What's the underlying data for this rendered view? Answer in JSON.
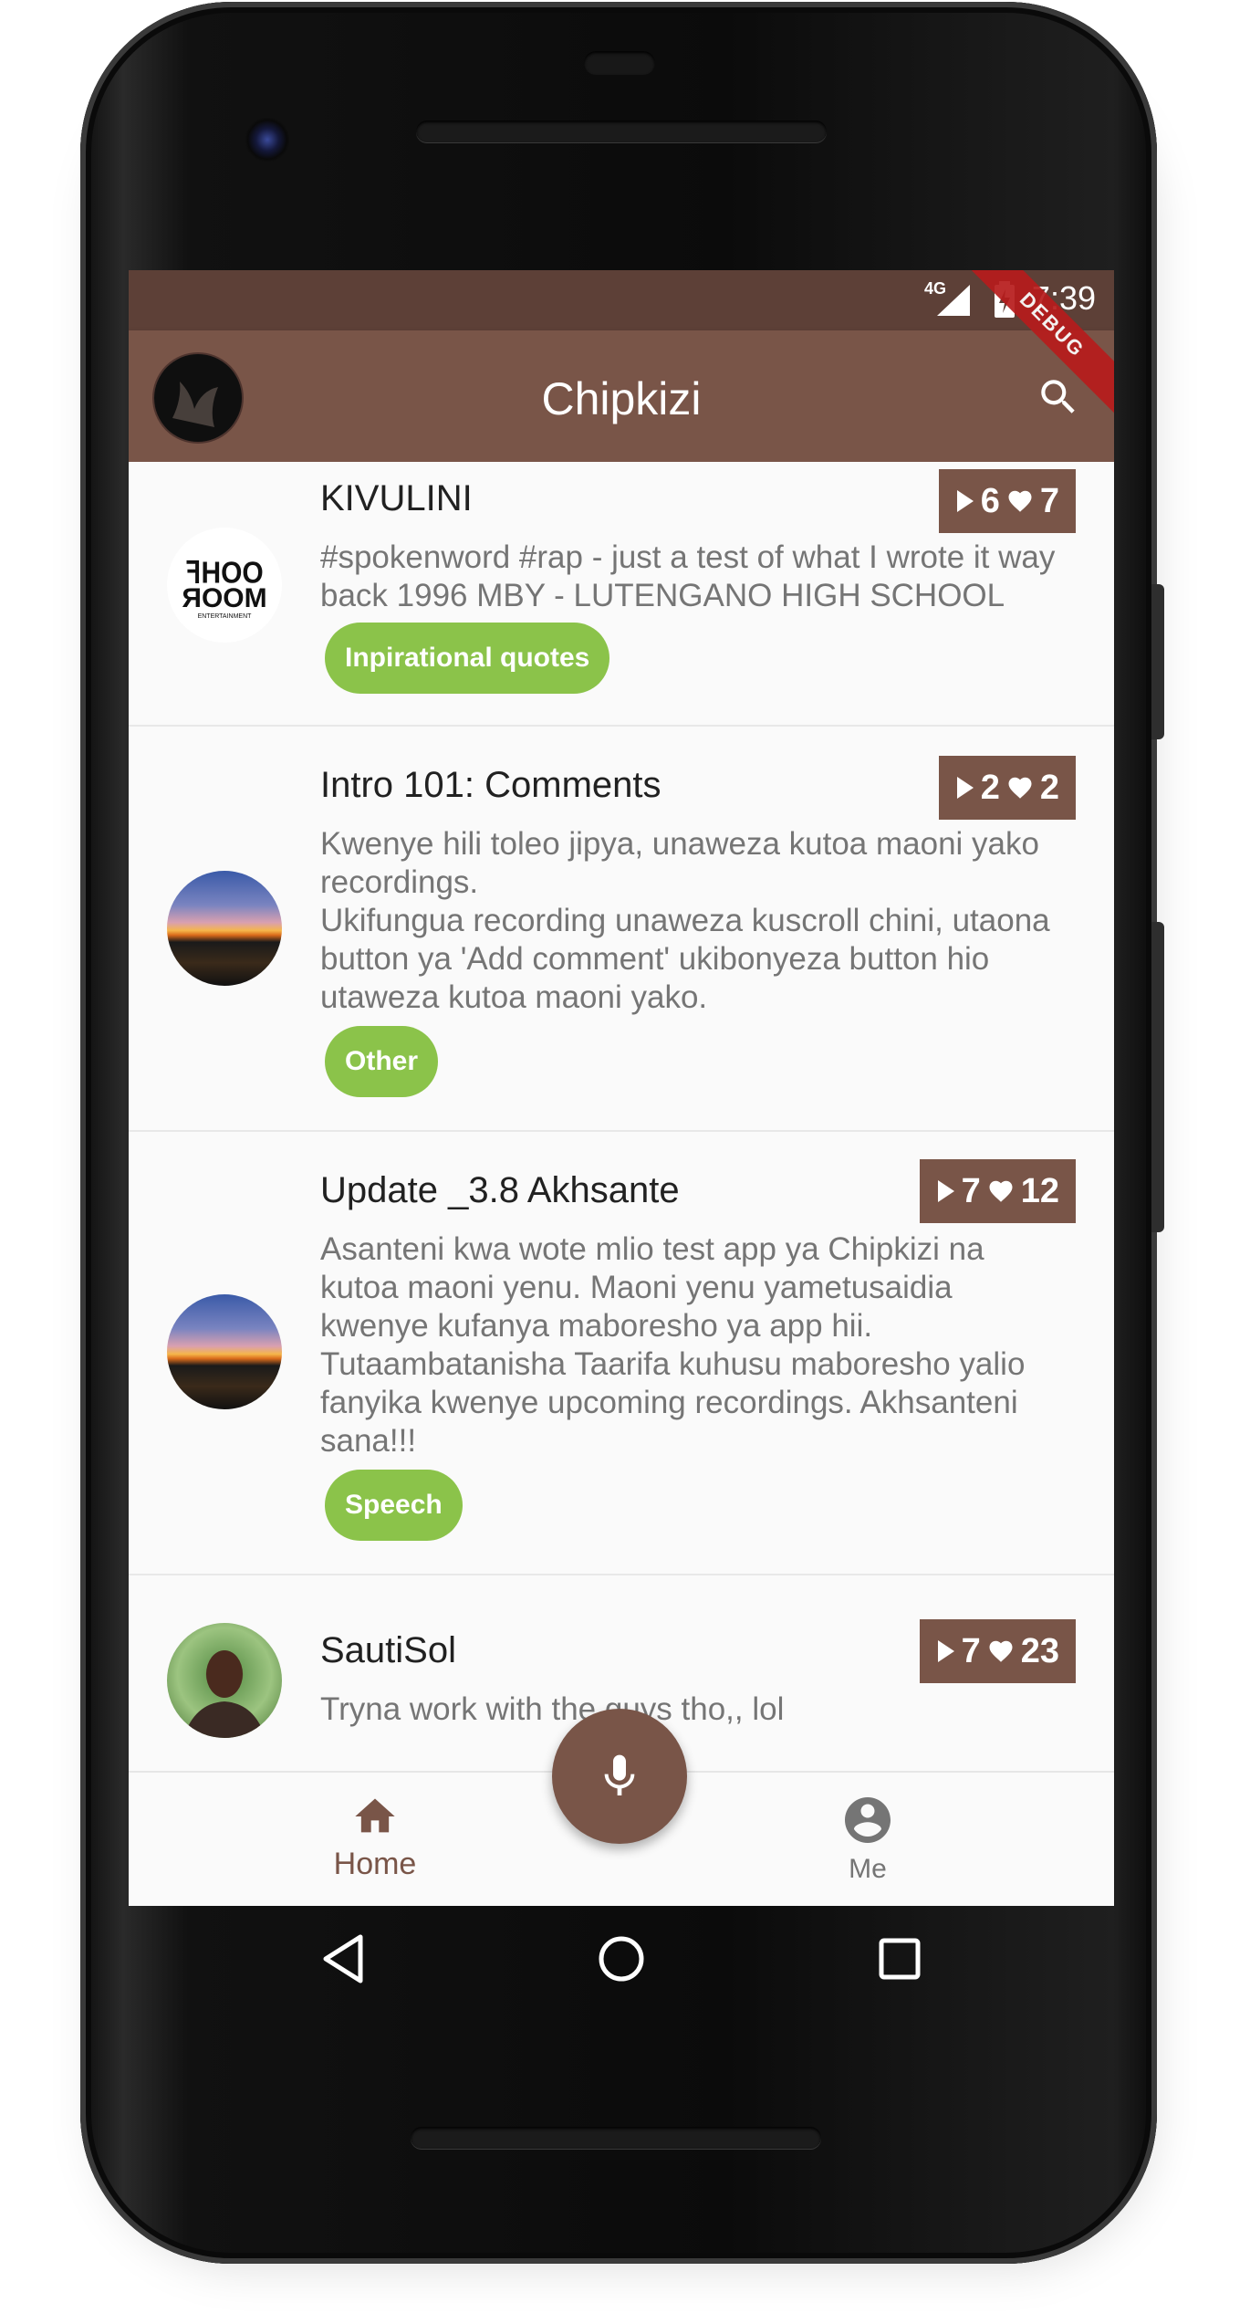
{
  "status_bar": {
    "network": "4G",
    "time": "7:39",
    "debug_label": "DEBUG"
  },
  "app_bar": {
    "title": "Chipkizi"
  },
  "feed": [
    {
      "title": "KIVULINI",
      "description": "#spokenword #rap - just a test of what I wrote it way back 1996 MBY - LUTENGANO HIGH SCHOOL",
      "tag": "Inpirational quotes",
      "plays": "6",
      "likes": "7",
      "avatar_text": "SHOO ROOM"
    },
    {
      "title": "Intro 101: Comments",
      "description": "Kwenye hili toleo jipya, unaweza kutoa maoni yako recordings.\nUkifungua recording unaweza kuscroll chini, utaona button ya 'Add comment' ukibonyeza button hio utaweza kutoa maoni yako.",
      "tag": "Other",
      "plays": "2",
      "likes": "2"
    },
    {
      "title": "Update _3.8 Akhsante",
      "description": "Asanteni kwa wote mlio test app ya Chipkizi na kutoa maoni yenu. Maoni yenu yametusaidia kwenye kufanya maboresho ya app hii. Tutaambatanisha Taarifa kuhusu maboresho yalio fanyika kwenye upcoming recordings. Akhsanteni sana!!!",
      "tag": "Speech",
      "plays": "7",
      "likes": "12"
    },
    {
      "title": "SautiSol",
      "description": "Tryna work with the guys tho,, lol",
      "plays": "7",
      "likes": "23"
    }
  ],
  "bottom_nav": {
    "home_label": "Home",
    "me_label": "Me",
    "active_color": "#795548",
    "inactive_color": "#757575"
  },
  "colors": {
    "primary": "#795548",
    "primary_dark": "#5d4037",
    "chip": "#8bc34a"
  }
}
